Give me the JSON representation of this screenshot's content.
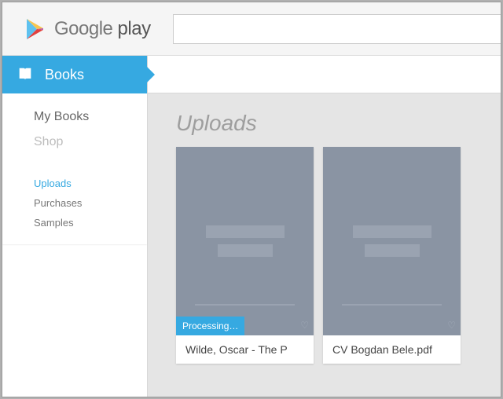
{
  "header": {
    "brand_a": "Google",
    "brand_b": " play",
    "search_value": ""
  },
  "sidebar": {
    "section_label": "Books",
    "primary": [
      {
        "label": "My Books",
        "key": "mybooks"
      },
      {
        "label": "Shop",
        "key": "shop"
      }
    ],
    "secondary": [
      {
        "label": "Uploads",
        "key": "uploads",
        "active": true
      },
      {
        "label": "Purchases",
        "key": "purchases"
      },
      {
        "label": "Samples",
        "key": "samples"
      }
    ]
  },
  "main": {
    "title": "Uploads",
    "cards": [
      {
        "title": "Wilde, Oscar - The P",
        "badge": "Processing…"
      },
      {
        "title": "CV Bogdan Bele.pdf",
        "badge": null
      }
    ]
  },
  "colors": {
    "accent": "#36a9e1"
  }
}
